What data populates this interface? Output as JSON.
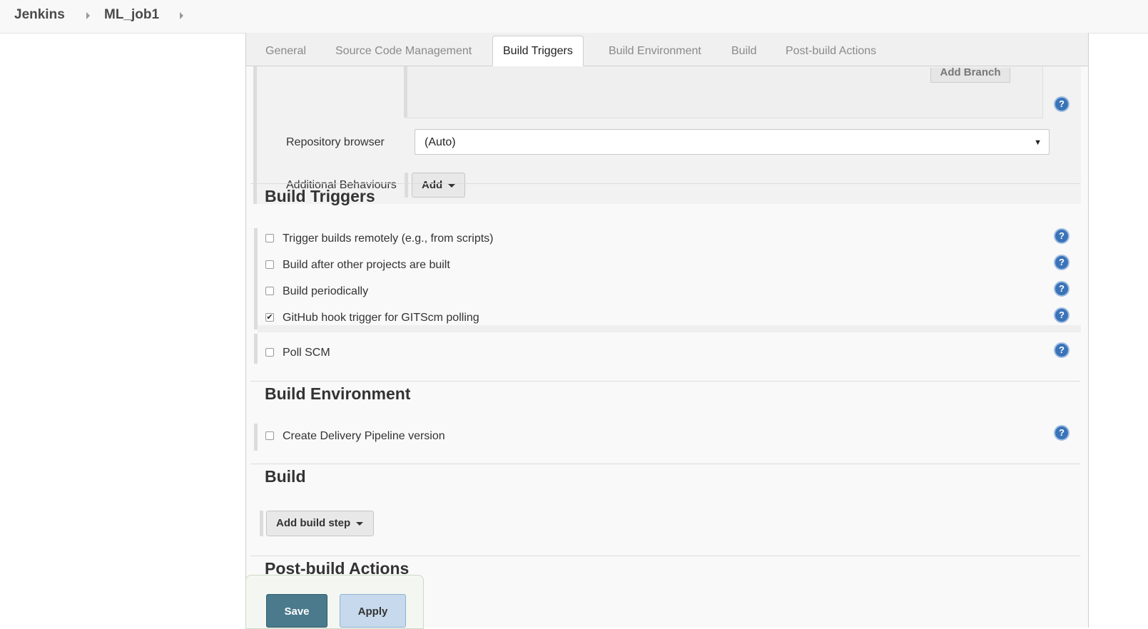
{
  "breadcrumb": {
    "items": [
      "Jenkins",
      "ML_job1"
    ]
  },
  "tabs": [
    {
      "label": "General",
      "active": false
    },
    {
      "label": "Source Code Management",
      "active": false
    },
    {
      "label": "Build Triggers",
      "active": true
    },
    {
      "label": "Build Environment",
      "active": false
    },
    {
      "label": "Build",
      "active": false
    },
    {
      "label": "Post-build Actions",
      "active": false
    }
  ],
  "scm": {
    "add_branch_label": "Add Branch",
    "repository_browser_label": "Repository browser",
    "repository_browser_value": "(Auto)",
    "additional_behaviours_label": "Additional Behaviours",
    "add_label": "Add"
  },
  "build_triggers": {
    "title": "Build Triggers",
    "options": [
      {
        "label": "Trigger builds remotely (e.g., from scripts)",
        "checked": false
      },
      {
        "label": "Build after other projects are built",
        "checked": false
      },
      {
        "label": "Build periodically",
        "checked": false
      },
      {
        "label": "GitHub hook trigger for GITScm polling",
        "checked": true
      },
      {
        "label": "Poll SCM",
        "checked": false
      }
    ]
  },
  "build_environment": {
    "title": "Build Environment",
    "options": [
      {
        "label": "Create Delivery Pipeline version",
        "checked": false
      }
    ]
  },
  "build": {
    "title": "Build",
    "add_step_label": "Add build step"
  },
  "post_build": {
    "title": "Post-build Actions"
  },
  "actions": {
    "save_label": "Save",
    "apply_label": "Apply"
  },
  "help_glyph": "?",
  "check_glyph": "✔",
  "dropdown_glyph": "▼",
  "colors": {
    "save_button": "#4a7a8c",
    "apply_button": "#c7d9ec",
    "help_icon": "#3a73b8"
  }
}
